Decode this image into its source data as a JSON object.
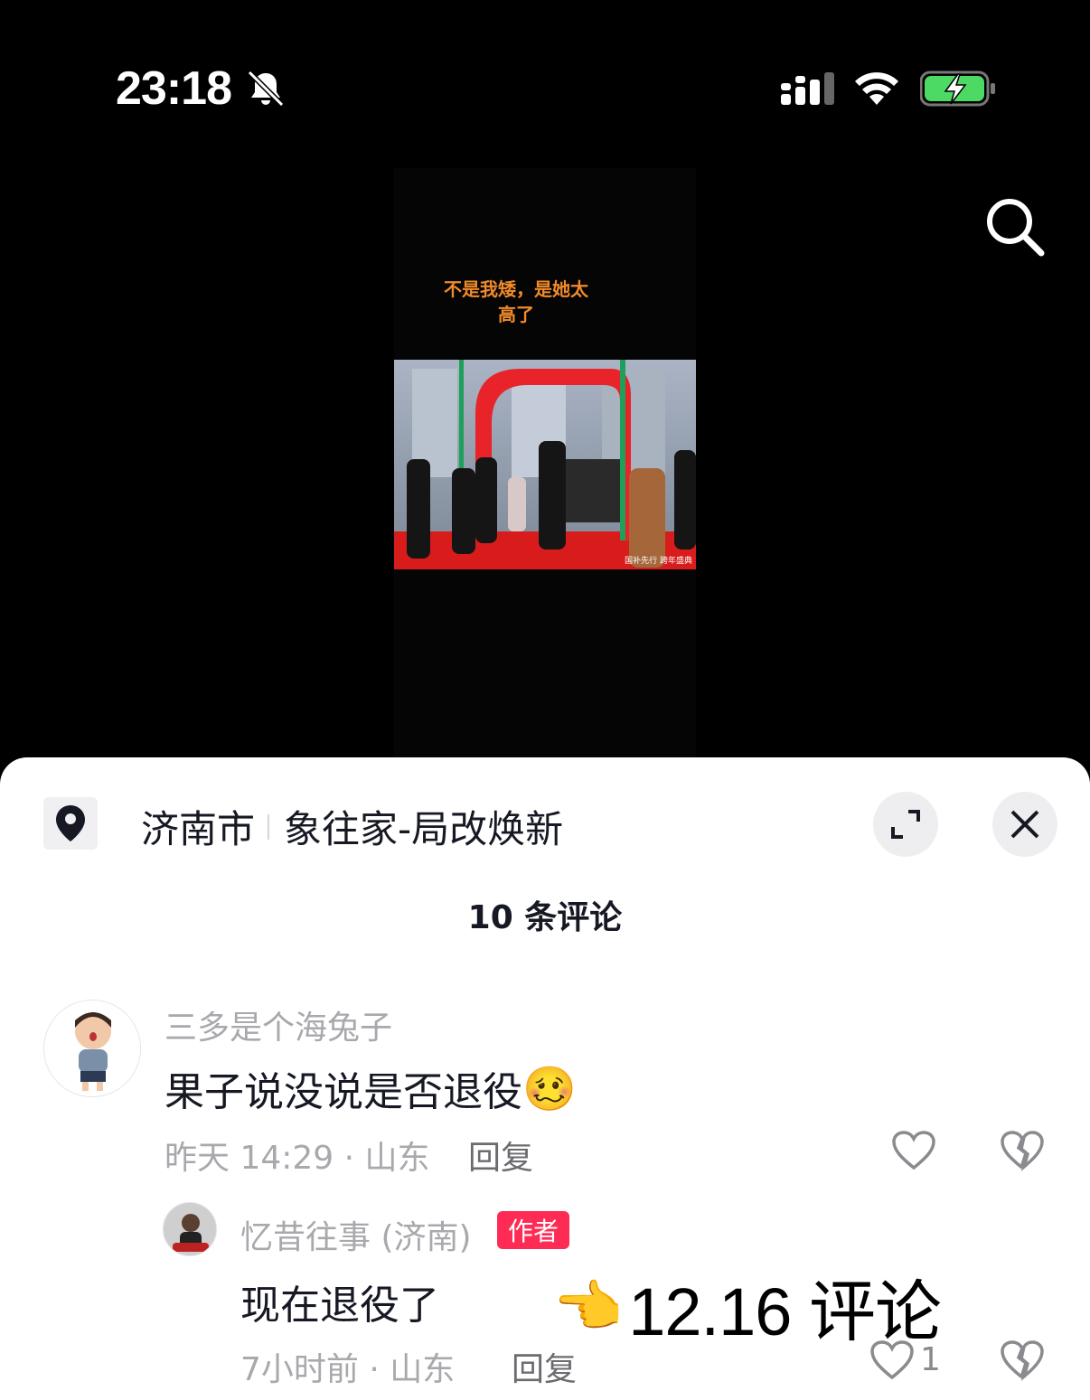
{
  "status_bar": {
    "time": "23:18",
    "icons": [
      "bell-off-icon",
      "signal-icon",
      "wifi-icon",
      "battery-charging-icon"
    ],
    "battery_color": "#4cd964"
  },
  "video": {
    "caption_line1": "不是我矮，是她太",
    "caption_line2": "高了",
    "caption_color": "#f08a2a",
    "watermark": "国补先行 跨年盛典"
  },
  "panel": {
    "location_city": "济南市",
    "location_name": "象往家-局改焕新",
    "comment_count": "10 条评论",
    "buttons": [
      "expand-icon",
      "close-icon"
    ]
  },
  "comments": [
    {
      "username": "三多是个海兔子",
      "text": "果子说没说是否退役",
      "emoji": "🥴",
      "meta": "昨天 14:29 · 山东",
      "reply_label": "回复"
    },
    {
      "username": "忆昔往事 (济南)",
      "badge": "作者",
      "text": "现在退役了",
      "meta": "7小时前 · 山东",
      "reply_label": "回复",
      "likes": "1"
    }
  ],
  "annotation": {
    "pointer": "👈",
    "text": "12.16 评论"
  },
  "accent_color": "#fe2c55"
}
